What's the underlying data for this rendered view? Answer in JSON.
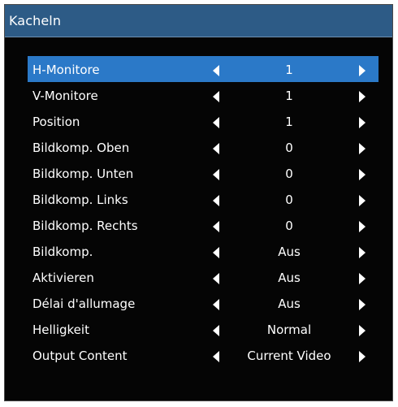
{
  "window": {
    "title": "Kacheln"
  },
  "colors": {
    "titlebar": "#2d5b86",
    "selected_row": "#2b79c8",
    "background": "#050505"
  },
  "rows": [
    {
      "label": "H-Monitore",
      "value": "1",
      "selected": true
    },
    {
      "label": "V-Monitore",
      "value": "1"
    },
    {
      "label": "Position",
      "value": "1"
    },
    {
      "label": "Bildkomp. Oben",
      "value": "0"
    },
    {
      "label": "Bildkomp. Unten",
      "value": "0"
    },
    {
      "label": "Bildkomp. Links",
      "value": "0"
    },
    {
      "label": "Bildkomp. Rechts",
      "value": "0"
    },
    {
      "label": "Bildkomp.",
      "value": "Aus"
    },
    {
      "label": "Aktivieren",
      "value": "Aus"
    },
    {
      "label": "Délai d'allumage",
      "value": "Aus"
    },
    {
      "label": "Helligkeit",
      "value": "Normal"
    },
    {
      "label": "Output Content",
      "value": "Current Video"
    }
  ]
}
